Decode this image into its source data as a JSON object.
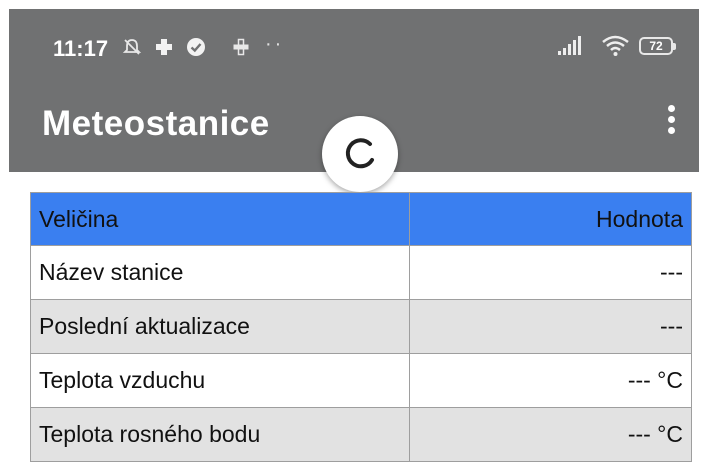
{
  "status_bar": {
    "time": "11:17",
    "overflow_dots": "··",
    "battery_level": "72"
  },
  "app_bar": {
    "title": "Meteostanice",
    "background": "#707172"
  },
  "table": {
    "header_color": "#3a7ff0",
    "headers": [
      "Veličina",
      "Hodnota"
    ],
    "rows": [
      {
        "name": "Název stanice",
        "value": "---"
      },
      {
        "name": "Poslední aktualizace",
        "value": "---"
      },
      {
        "name": "Teplota vzduchu",
        "value": "--- °C"
      },
      {
        "name": "Teplota rosného bodu",
        "value": "--- °C"
      }
    ]
  }
}
